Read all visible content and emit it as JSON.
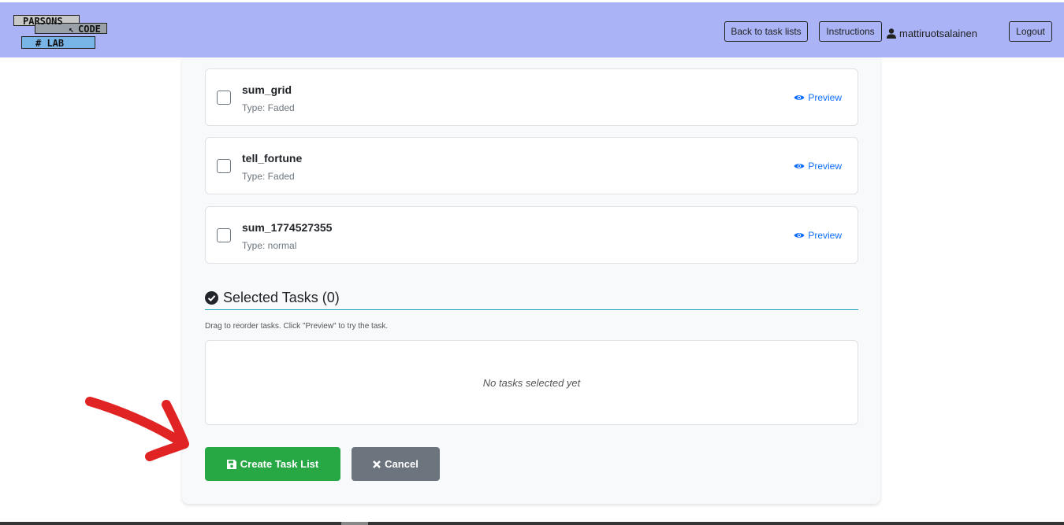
{
  "header": {
    "logo": {
      "line1": "PARSONS",
      "line2": "CODE",
      "line3": "# LAB"
    },
    "back_label": "Back to task lists",
    "instructions_label": "Instructions",
    "username": "mattiruotsalainen",
    "logout_label": "Logout"
  },
  "tasks": [
    {
      "name": "sum_grid",
      "type": "Type: Faded",
      "preview": "Preview"
    },
    {
      "name": "tell_fortune",
      "type": "Type: Faded",
      "preview": "Preview"
    },
    {
      "name": "sum_1774527355",
      "type": "Type: normal",
      "preview": "Preview"
    }
  ],
  "selected": {
    "title": "Selected Tasks (0)",
    "hint": "Drag to reorder tasks. Click \"Preview\" to try the task.",
    "empty": "No tasks selected yet"
  },
  "actions": {
    "create_label": "Create Task List",
    "cancel_label": "Cancel"
  },
  "colors": {
    "navbar": "#a9b3f5",
    "create": "#28a745",
    "cancel": "#6c757d",
    "preview_link": "#0d6efd",
    "annotation_arrow": "#e02424"
  },
  "icons": {
    "user": "user-icon",
    "preview": "eye-icon",
    "selected": "check-circle-icon",
    "create": "save-icon",
    "cancel": "times-icon"
  }
}
